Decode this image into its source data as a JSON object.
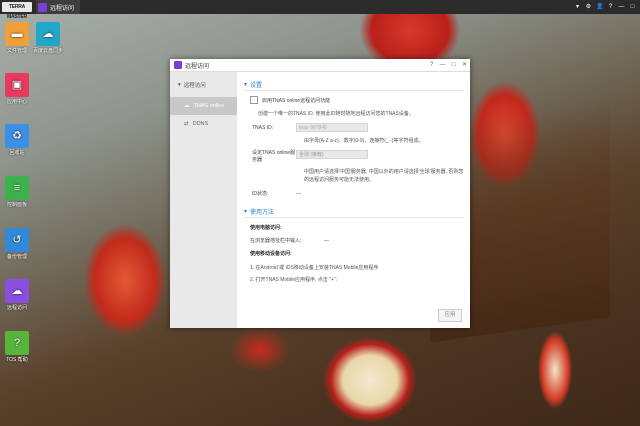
{
  "taskbar": {
    "brand": "TERRA MASTER",
    "active_app": "远程访问",
    "tray": [
      "▾",
      "⚙",
      "👤",
      "?",
      "—",
      "□"
    ]
  },
  "desktop_icons": [
    {
      "label": "文件管理",
      "icon": "folder-icon",
      "color": "#f0a03a"
    },
    {
      "label": "百度云盘同步",
      "icon": "cloud-sync-icon",
      "color": "#23a7c8"
    },
    {
      "label": "应用中心",
      "icon": "app-center-icon",
      "color": "#e73a5e"
    },
    {
      "label": "回收站",
      "icon": "recycle-bin-icon",
      "color": "#3b8fe8"
    },
    {
      "label": "控制面板",
      "icon": "control-panel-icon",
      "color": "#3cb24a"
    },
    {
      "label": "备份管理",
      "icon": "backup-icon",
      "color": "#2f8bd9"
    },
    {
      "label": "远程访问",
      "icon": "remote-access-icon",
      "color": "#8a4fe0"
    },
    {
      "label": "TOS 帮助",
      "icon": "help-icon",
      "color": "#57b53b"
    }
  ],
  "window": {
    "title": "远程访问",
    "controls": [
      "?",
      "—",
      "□",
      "✕"
    ],
    "sidebar": {
      "header": "远程访问",
      "items": [
        {
          "label": "TNAS online",
          "active": true
        },
        {
          "label": "DDNS",
          "active": false
        }
      ]
    },
    "settings": {
      "section": "设置",
      "enable_label": "启用TNAS online远程访问功能",
      "desc": "创建一个唯一的TNAS ID, 使用此ID随时随地远程访问您的TNAS设备。",
      "tnas_id_label": "TNAS ID:",
      "tnas_id_placeholder": "tnas-997846",
      "tnas_id_hint": "由字母(A-Z a-z)、数字(0-9)、连接符(_ -)等字符组成。",
      "server_label": "设定TNAS online服务器",
      "server_value": "全球 (推荐)",
      "server_note": "中国用户请选择'中国'服务器, 中国以外的用户请选择'全球'服务器, 否则您的远程访问服务可能无法使用。",
      "status_label": "ID状态:",
      "status_value": "—"
    },
    "usage": {
      "section": "使用方法",
      "pc_title": "使用电脑访问:",
      "pc_line": "在浏览器地址栏中输入:",
      "pc_value": "—",
      "mobile_title": "使用移动设备访问:",
      "mobile_step1": "1. 在Android 或 iOS移动设备上安装TNAS Mobile应用程序",
      "mobile_step2": "2. 打开TNAS Mobile应用程序, 点击 \"+\";"
    },
    "apply_button": "应用"
  }
}
